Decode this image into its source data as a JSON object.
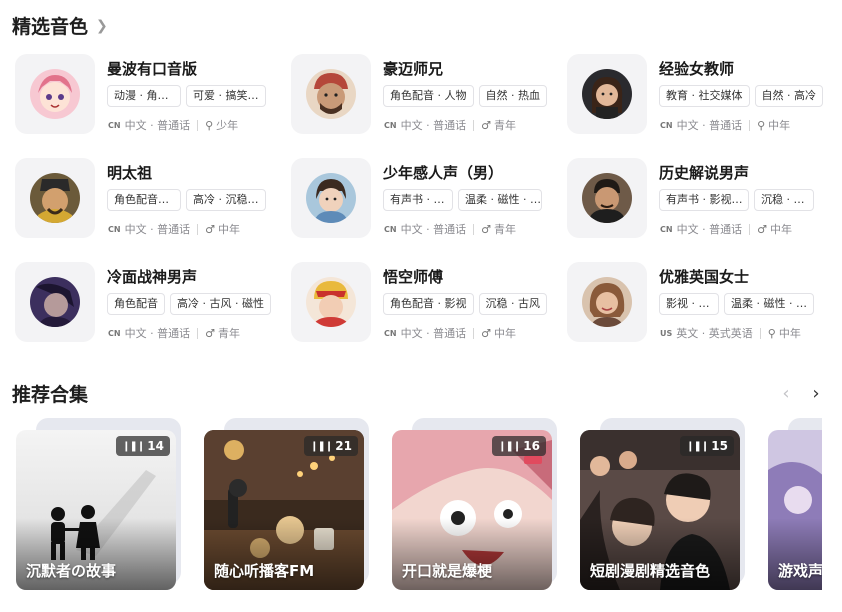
{
  "featured": {
    "title": "精选音色",
    "more_icon": "chevron-right-icon",
    "voices": [
      {
        "name": "曼波有口音版",
        "tags": [
          "动漫 · 角…",
          "可爱 · 搞笑…"
        ],
        "country": "CN",
        "language": "中文 · 普通话",
        "gender_icon": "location-pin-icon",
        "age": "少年",
        "avatar_color": "#e78fa0"
      },
      {
        "name": "豪迈师兄",
        "tags": [
          "角色配音 · 人物",
          "自然 · 热血"
        ],
        "country": "CN",
        "language": "中文 · 普通话",
        "gender_icon": "male-icon",
        "age": "青年",
        "avatar_color": "#b98a6b"
      },
      {
        "name": "经验女教师",
        "tags": [
          "教育 · 社交媒体",
          "自然 · 高冷"
        ],
        "country": "CN",
        "language": "中文 · 普通话",
        "gender_icon": "location-pin-icon",
        "age": "中年",
        "avatar_color": "#5c3b2e"
      },
      {
        "name": "明太祖",
        "tags": [
          "角色配音…",
          "高冷 · 沉稳…"
        ],
        "country": "CN",
        "language": "中文 · 普通话",
        "gender_icon": "male-icon",
        "age": "中年",
        "avatar_color": "#c49a3a"
      },
      {
        "name": "少年感人声（男）",
        "tags": [
          "有声书 · …",
          "温柔 · 磁性 · …"
        ],
        "country": "CN",
        "language": "中文 · 普通话",
        "gender_icon": "male-icon",
        "age": "青年",
        "avatar_color": "#7aa6c9"
      },
      {
        "name": "历史解说男声",
        "tags": [
          "有声书 · 影视…",
          "沉稳 · …"
        ],
        "country": "CN",
        "language": "中文 · 普通话",
        "gender_icon": "male-icon",
        "age": "中年",
        "avatar_color": "#4b3a2f"
      },
      {
        "name": "冷面战神男声",
        "tags": [
          "角色配音",
          "高冷 · 古风 · 磁性"
        ],
        "country": "CN",
        "language": "中文 · 普通话",
        "gender_icon": "male-icon",
        "age": "青年",
        "avatar_color": "#5a4a7a"
      },
      {
        "name": "悟空师傅",
        "tags": [
          "角色配音 · 影视",
          "沉稳 · 古风"
        ],
        "country": "CN",
        "language": "中文 · 普通话",
        "gender_icon": "male-icon",
        "age": "中年",
        "avatar_color": "#d9534f"
      },
      {
        "name": "优雅英国女士",
        "tags": [
          "影视 · …",
          "温柔 · 磁性 · …"
        ],
        "country": "US",
        "language": "英文 · 英式英语",
        "gender_icon": "location-pin-icon",
        "age": "中年",
        "avatar_color": "#b07a5a"
      }
    ]
  },
  "collections": {
    "title": "推荐合集",
    "prev_icon": "chevron-left-icon",
    "next_icon": "chevron-right-icon",
    "items": [
      {
        "title": "沉默者の故事",
        "count": "14",
        "count_icon": "audio-bars-icon"
      },
      {
        "title": "随心听播客FM",
        "count": "21",
        "count_icon": "audio-bars-icon"
      },
      {
        "title": "开口就是爆梗",
        "count": "16",
        "count_icon": "audio-bars-icon"
      },
      {
        "title": "短剧漫剧精选音色",
        "count": "15",
        "count_icon": "audio-bars-icon"
      },
      {
        "title": "游戏声",
        "count": "",
        "count_icon": "audio-bars-icon"
      }
    ]
  }
}
